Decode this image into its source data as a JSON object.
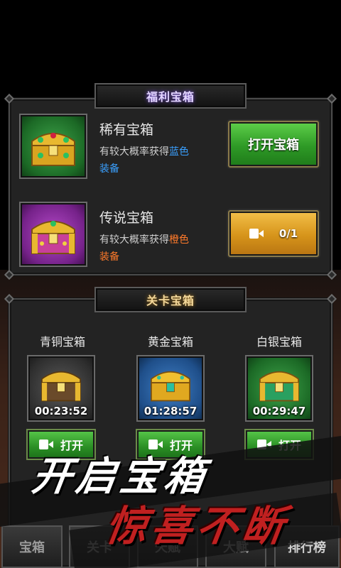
{
  "welfare": {
    "title": "福利宝箱",
    "items": [
      {
        "name": "稀有宝箱",
        "desc_prefix": "有较大概率获得",
        "desc_color_word": "蓝色",
        "desc_suffix": "装备",
        "button_label": "打开宝箱"
      },
      {
        "name": "传说宝箱",
        "desc_prefix": "有较大概率获得",
        "desc_color_word": "橙色",
        "desc_suffix": "装备",
        "button_progress": "0/1"
      }
    ]
  },
  "stage": {
    "title": "关卡宝箱",
    "chests": [
      {
        "label": "青铜宝箱",
        "timer": "00:23:52",
        "button_label": "打开"
      },
      {
        "label": "黄金宝箱",
        "timer": "01:28:57",
        "button_label": "打开"
      },
      {
        "label": "白银宝箱",
        "timer": "00:29:47",
        "button_label": "打开"
      }
    ]
  },
  "banner": {
    "line1": "开启宝箱",
    "line2": "惊喜不断"
  },
  "tabs": [
    "宝箱",
    "关卡",
    "天赋",
    "大赋",
    "排行榜"
  ],
  "colors": {
    "blue_text": "#3aa0ff",
    "orange_text": "#ff7a2a",
    "green_button": "#2e9a26",
    "orange_button": "#d6941a"
  }
}
